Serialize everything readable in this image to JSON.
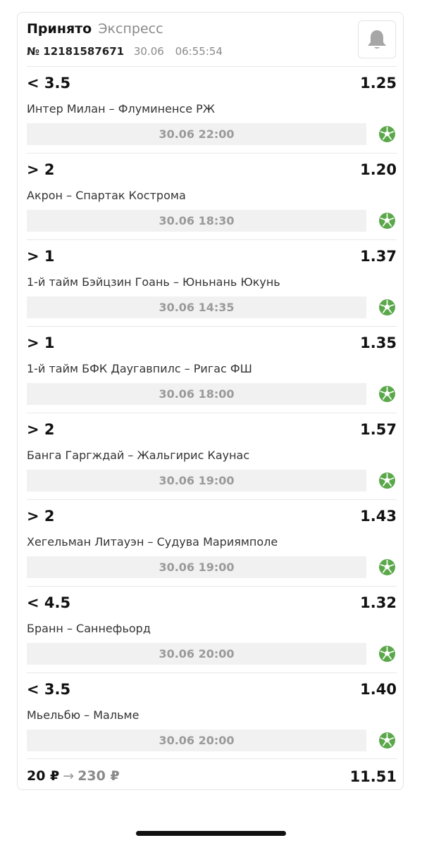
{
  "bet": {
    "status": "Принято",
    "type": "Экспресс",
    "number": "№ 12181587671",
    "date": "30.06",
    "time": "06:55:54"
  },
  "events": [
    {
      "outcome": "< 3.5",
      "odds": "1.25",
      "teams": "Интер Милан – Флуминенсе РЖ",
      "start": "30.06 22:00",
      "sport_icon": "soccer-ball-icon"
    },
    {
      "outcome": "> 2",
      "odds": "1.20",
      "teams": "Акрон – Спартак Кострома",
      "start": "30.06 18:30",
      "sport_icon": "soccer-ball-icon"
    },
    {
      "outcome": "> 1",
      "odds": "1.37",
      "teams": "1-й тайм Бэйцзин Гоань – Юньнань Юкунь",
      "start": "30.06 14:35",
      "sport_icon": "soccer-ball-icon"
    },
    {
      "outcome": "> 1",
      "odds": "1.35",
      "teams": "1-й тайм БФК Даугавпилс – Ригас ФШ",
      "start": "30.06 18:00",
      "sport_icon": "soccer-ball-icon"
    },
    {
      "outcome": "> 2",
      "odds": "1.57",
      "teams": "Банга Гаргждай – Жальгирис Каунас",
      "start": "30.06 19:00",
      "sport_icon": "soccer-ball-icon"
    },
    {
      "outcome": "> 2",
      "odds": "1.43",
      "teams": "Хегельман Литауэн – Судува Мариямполе",
      "start": "30.06 19:00",
      "sport_icon": "soccer-ball-icon"
    },
    {
      "outcome": "< 4.5",
      "odds": "1.32",
      "teams": "Бранн – Саннефьорд",
      "start": "30.06 20:00",
      "sport_icon": "soccer-ball-icon"
    },
    {
      "outcome": "< 3.5",
      "odds": "1.40",
      "teams": "Мьельбю – Мальме",
      "start": "30.06 20:00",
      "sport_icon": "soccer-ball-icon"
    }
  ],
  "footer": {
    "stake": "20 ₽",
    "arrow": "→",
    "payout": "230 ₽",
    "total_odds": "11.51"
  },
  "colors": {
    "accent_green": "#5aa84a",
    "muted_gray": "#8a8a8a",
    "bar_background": "#f1f1f1"
  },
  "icons": {
    "notification": "bell-icon",
    "sport": "soccer-ball-icon"
  }
}
